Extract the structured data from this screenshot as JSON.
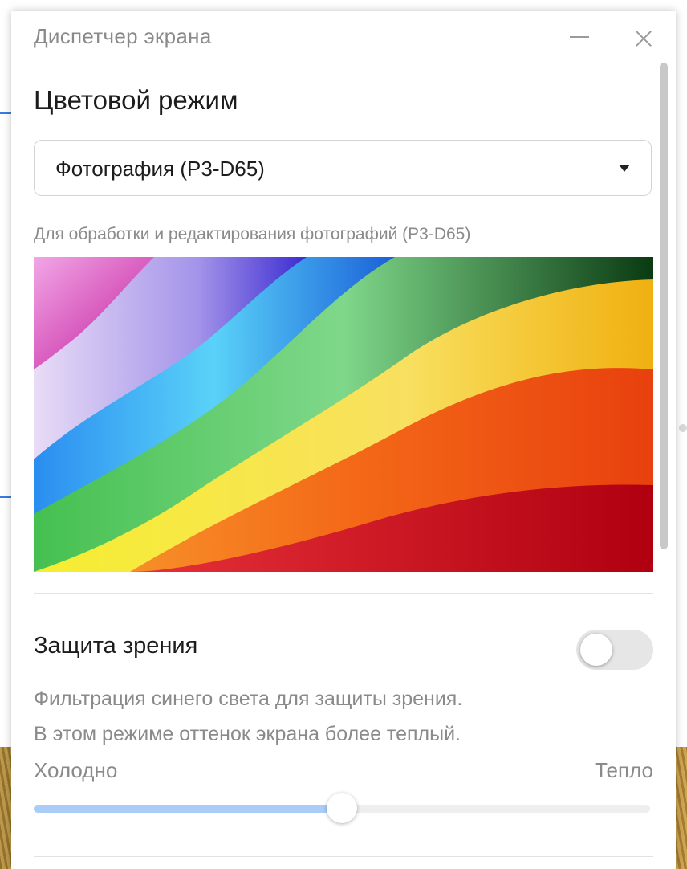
{
  "window": {
    "title": "Диспетчер экрана"
  },
  "color_mode": {
    "heading": "Цветовой режим",
    "selected": "Фотография (P3-D65)",
    "description": "Для обработки и редактирования фотографий (P3-D65)"
  },
  "eye_protection": {
    "heading": "Защита зрения",
    "enabled": false,
    "description_line1": "Фильтрация синего света для защиты зрения.",
    "description_line2": "В этом режиме оттенок экрана более теплый.",
    "slider_left_label": "Холодно",
    "slider_right_label": "Тепло",
    "slider_value_fraction": 0.5
  },
  "colors": {
    "accent": "#a9cdf6",
    "toggle_off": "#e6e6e6"
  }
}
